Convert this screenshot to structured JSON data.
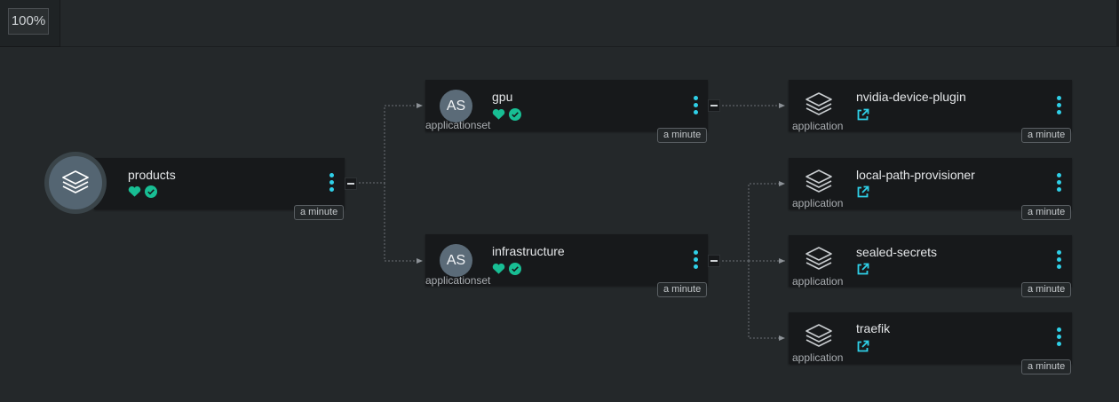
{
  "toolbar": {
    "zoom_label": "100%"
  },
  "colors": {
    "accent": "#2fd0e8",
    "healthy": "#18be94",
    "node_bg": "#17191b",
    "canvas_bg": "#24282a"
  },
  "root": {
    "title": "products",
    "age": "a minute",
    "icon": "layers-icon",
    "health": "heart-icon",
    "sync": "check-circle-icon"
  },
  "appsets": [
    {
      "title": "gpu",
      "kind": "applicationset",
      "badge": "AS",
      "age": "a minute"
    },
    {
      "title": "infrastructure",
      "kind": "applicationset",
      "badge": "AS",
      "age": "a minute"
    }
  ],
  "apps": [
    {
      "title": "nvidia-device-plugin",
      "kind": "application",
      "age": "a minute"
    },
    {
      "title": "local-path-provisioner",
      "kind": "application",
      "age": "a minute"
    },
    {
      "title": "sealed-secrets",
      "kind": "application",
      "age": "a minute"
    },
    {
      "title": "traefik",
      "kind": "application",
      "age": "a minute"
    }
  ]
}
